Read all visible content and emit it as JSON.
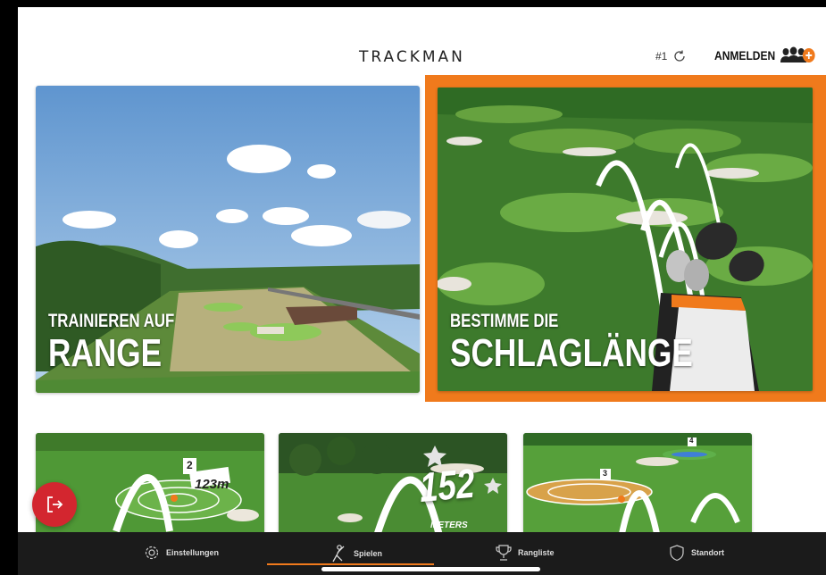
{
  "header": {
    "brand": "TRACKMAN",
    "queue_label": "#1",
    "login_label": "ANMELDEN"
  },
  "cards": [
    {
      "line1": "TRAINIEREN AUF",
      "line2": "RANGE",
      "selected": false
    },
    {
      "line1": "BESTIMME DIE",
      "line2": "SCHLAGLÄNGE",
      "selected": true
    }
  ],
  "thumbs": [
    {
      "flag": "2",
      "distance": "123m"
    },
    {
      "distance": "152",
      "unit": "METERS"
    },
    {
      "flag": "3",
      "flag2": "4"
    }
  ],
  "tabs": [
    {
      "label": "Einstellungen",
      "icon": "gear-icon"
    },
    {
      "label": "Spielen",
      "icon": "golf-swing-icon",
      "active": true
    },
    {
      "label": "Rangliste",
      "icon": "trophy-icon"
    },
    {
      "label": "Standort",
      "icon": "shield-icon"
    }
  ],
  "colors": {
    "accent": "#f07a1c",
    "exit": "#d3262f",
    "tabbar": "#1b1b1b"
  }
}
